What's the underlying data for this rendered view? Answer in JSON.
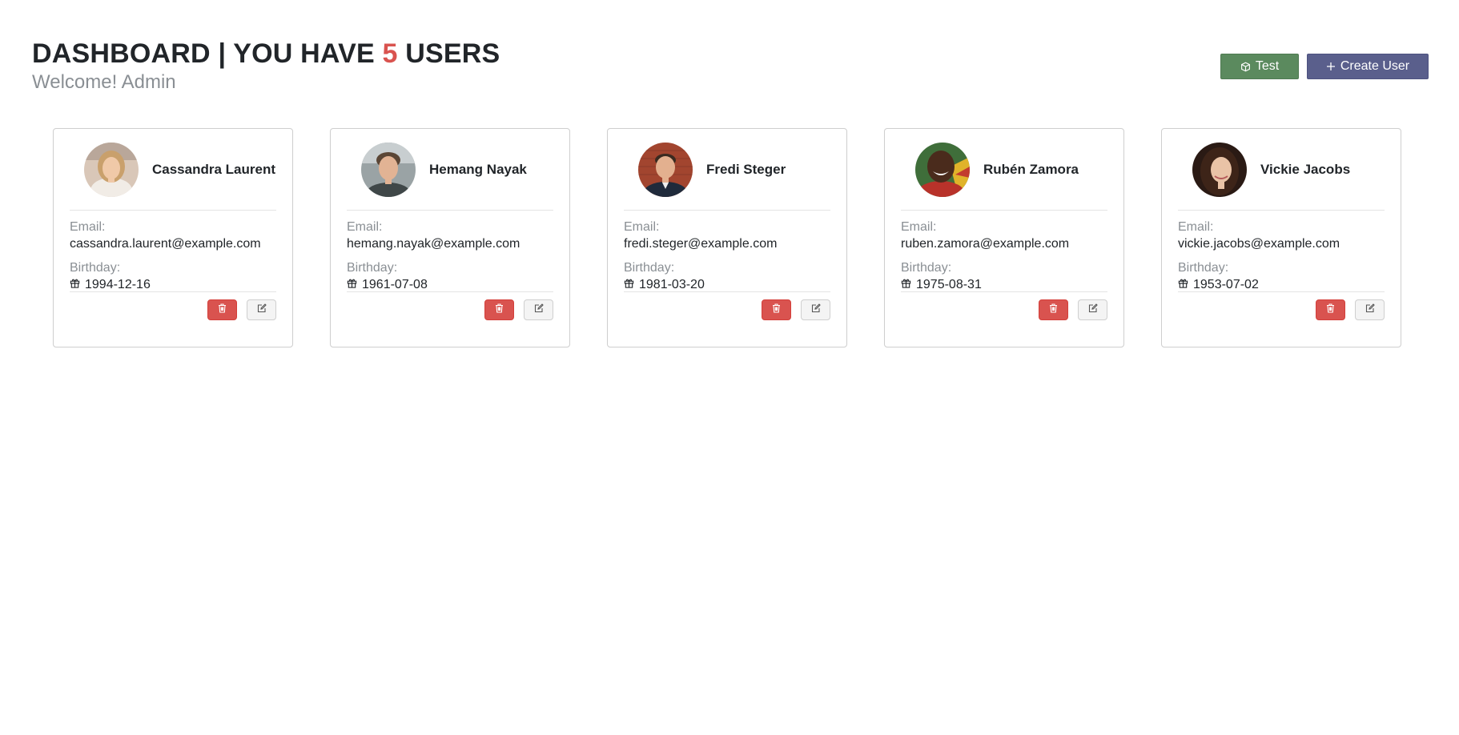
{
  "header": {
    "title_prefix": "DASHBOARD | YOU HAVE",
    "user_count": "5",
    "title_suffix": "USERS",
    "welcome": "Welcome! Admin"
  },
  "actions": {
    "test_label": "Test",
    "create_label": "Create User"
  },
  "card_labels": {
    "email": "Email:",
    "birthday": "Birthday:"
  },
  "users": [
    {
      "name": "Cassandra Laurent",
      "email": "cassandra.laurent@example.com",
      "birthday": "1994-12-16"
    },
    {
      "name": "Hemang Nayak",
      "email": "hemang.nayak@example.com",
      "birthday": "1961-07-08"
    },
    {
      "name": "Fredi Steger",
      "email": "fredi.steger@example.com",
      "birthday": "1981-03-20"
    },
    {
      "name": "Rubén Zamora",
      "email": "ruben.zamora@example.com",
      "birthday": "1975-08-31"
    },
    {
      "name": "Vickie Jacobs",
      "email": "vickie.jacobs@example.com",
      "birthday": "1953-07-02"
    }
  ],
  "colors": {
    "accent_count": "#d9534f",
    "test_button": "#5b8a5e",
    "create_button": "#5a5f8c",
    "delete_button": "#d9534f",
    "edit_button": "#f4f4f4"
  },
  "icons": {
    "test_button": "cube-icon",
    "create_button": "plus-icon",
    "birthday": "gift-icon",
    "delete": "trash-icon",
    "edit": "edit-icon"
  }
}
